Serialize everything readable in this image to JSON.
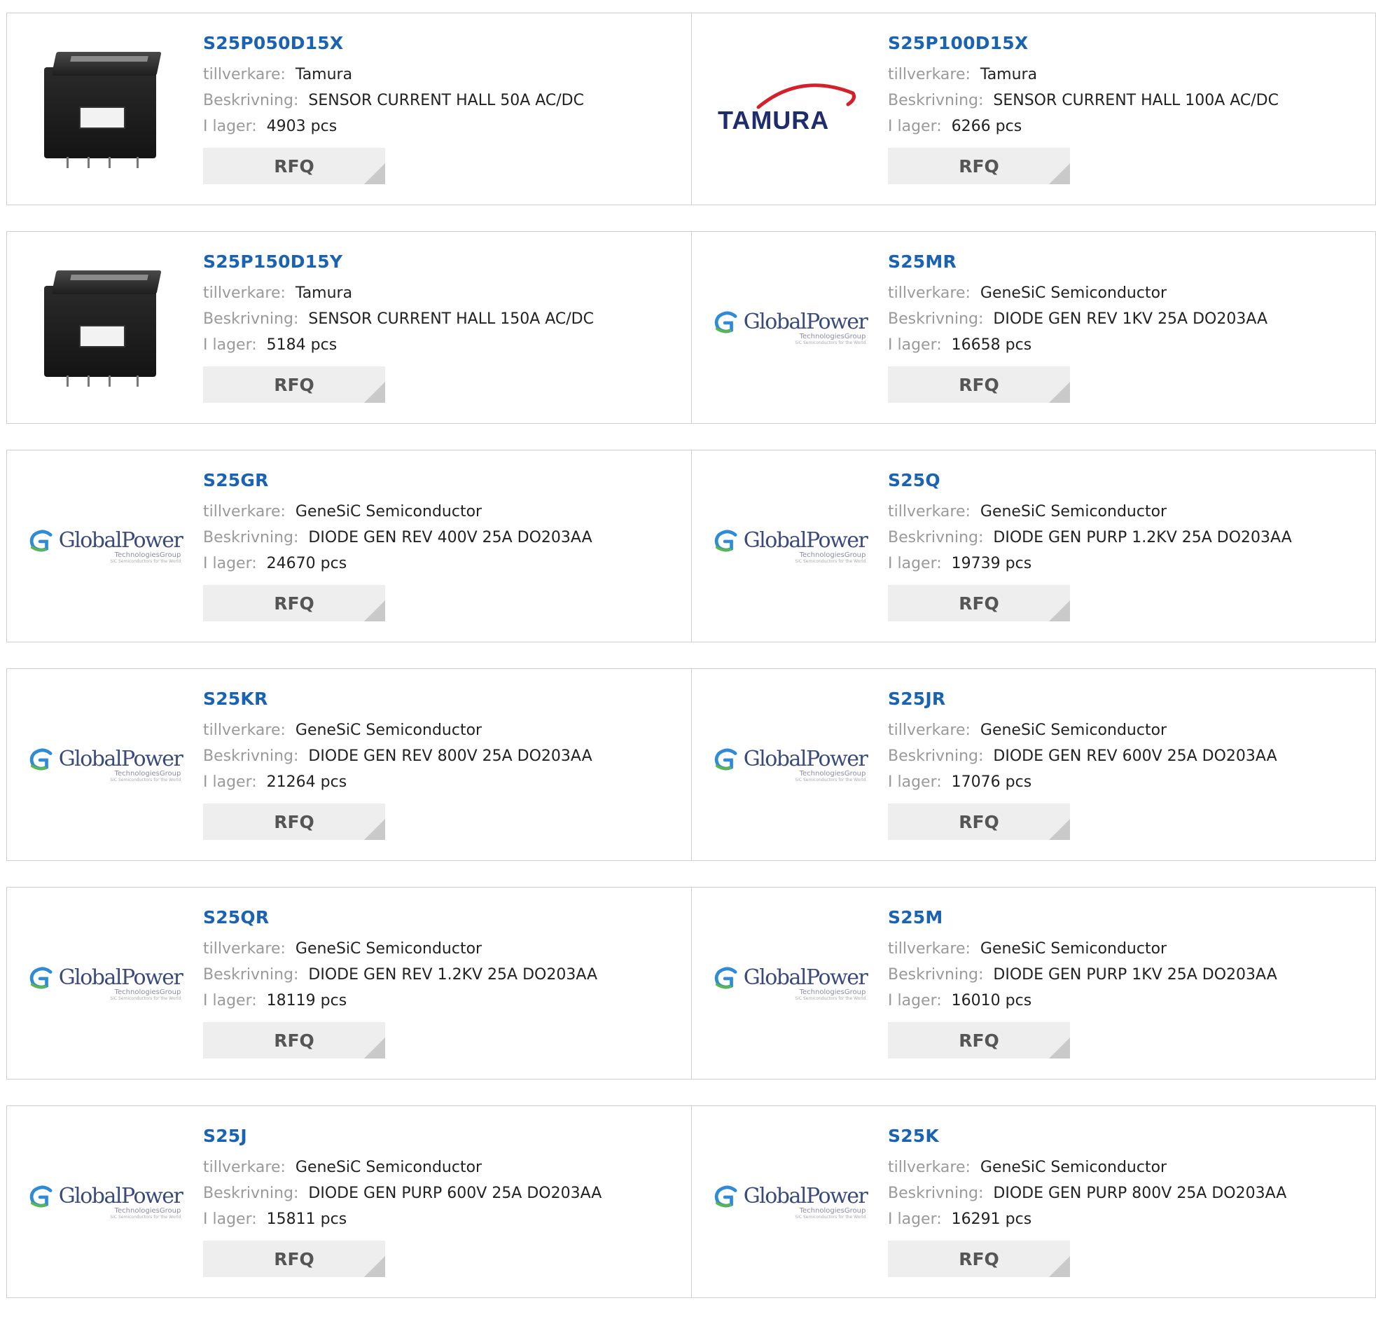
{
  "labels": {
    "manufacturer": "tillverkare:",
    "description": "Beskrivning:",
    "stock": "I lager:",
    "rfq": "RFQ"
  },
  "logos": {
    "globalpower_text": "GlobalPower",
    "globalpower_sub": "TechnologiesGroup",
    "globalpower_tiny": "SiC Semiconductors for the World",
    "tamura_text": "TAMURA"
  },
  "products": [
    {
      "part": "S25P050D15X",
      "manufacturer": "Tamura",
      "description": "SENSOR CURRENT HALL 50A AC/DC",
      "stock": "4903 pcs",
      "image": "sensor"
    },
    {
      "part": "S25P100D15X",
      "manufacturer": "Tamura",
      "description": "SENSOR CURRENT HALL 100A AC/DC",
      "stock": "6266 pcs",
      "image": "tamura-logo"
    },
    {
      "part": "S25P150D15Y",
      "manufacturer": "Tamura",
      "description": "SENSOR CURRENT HALL 150A AC/DC",
      "stock": "5184 pcs",
      "image": "sensor"
    },
    {
      "part": "S25MR",
      "manufacturer": "GeneSiC Semiconductor",
      "description": "DIODE GEN REV 1KV 25A DO203AA",
      "stock": "16658 pcs",
      "image": "globalpower-logo"
    },
    {
      "part": "S25GR",
      "manufacturer": "GeneSiC Semiconductor",
      "description": "DIODE GEN REV 400V 25A DO203AA",
      "stock": "24670 pcs",
      "image": "globalpower-logo"
    },
    {
      "part": "S25Q",
      "manufacturer": "GeneSiC Semiconductor",
      "description": "DIODE GEN PURP 1.2KV 25A DO203AA",
      "stock": "19739 pcs",
      "image": "globalpower-logo"
    },
    {
      "part": "S25KR",
      "manufacturer": "GeneSiC Semiconductor",
      "description": "DIODE GEN REV 800V 25A DO203AA",
      "stock": "21264 pcs",
      "image": "globalpower-logo"
    },
    {
      "part": "S25JR",
      "manufacturer": "GeneSiC Semiconductor",
      "description": "DIODE GEN REV 600V 25A DO203AA",
      "stock": "17076 pcs",
      "image": "globalpower-logo"
    },
    {
      "part": "S25QR",
      "manufacturer": "GeneSiC Semiconductor",
      "description": "DIODE GEN REV 1.2KV 25A DO203AA",
      "stock": "18119 pcs",
      "image": "globalpower-logo"
    },
    {
      "part": "S25M",
      "manufacturer": "GeneSiC Semiconductor",
      "description": "DIODE GEN PURP 1KV 25A DO203AA",
      "stock": "16010 pcs",
      "image": "globalpower-logo"
    },
    {
      "part": "S25J",
      "manufacturer": "GeneSiC Semiconductor",
      "description": "DIODE GEN PURP 600V 25A DO203AA",
      "stock": "15811 pcs",
      "image": "globalpower-logo"
    },
    {
      "part": "S25K",
      "manufacturer": "GeneSiC Semiconductor",
      "description": "DIODE GEN PURP 800V 25A DO203AA",
      "stock": "16291 pcs",
      "image": "globalpower-logo"
    }
  ],
  "colors": {
    "part_link": "#1b63b0",
    "label": "#9a9a9a",
    "value": "#222222",
    "rfq_bg": "#eeeeee",
    "border": "#cfcfcf"
  }
}
